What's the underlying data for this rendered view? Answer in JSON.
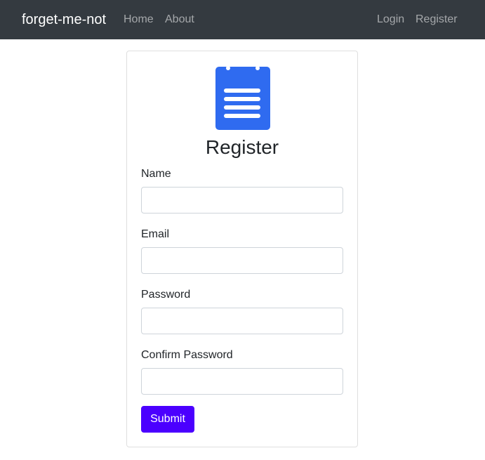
{
  "navbar": {
    "brand": "forget-me-not",
    "left_links": [
      "Home",
      "About"
    ],
    "right_links": [
      "Login",
      "Register"
    ],
    "background": "#343a40"
  },
  "form": {
    "icon": "clipboard-icon",
    "icon_color": "#2f6bf0",
    "title": "Register",
    "fields": [
      {
        "label": "Name",
        "value": "",
        "placeholder": ""
      },
      {
        "label": "Email",
        "value": "",
        "placeholder": ""
      },
      {
        "label": "Password",
        "value": "",
        "placeholder": ""
      },
      {
        "label": "Confirm Password",
        "value": "",
        "placeholder": ""
      }
    ],
    "submit_label": "Submit",
    "submit_color": "#4b00ff"
  }
}
